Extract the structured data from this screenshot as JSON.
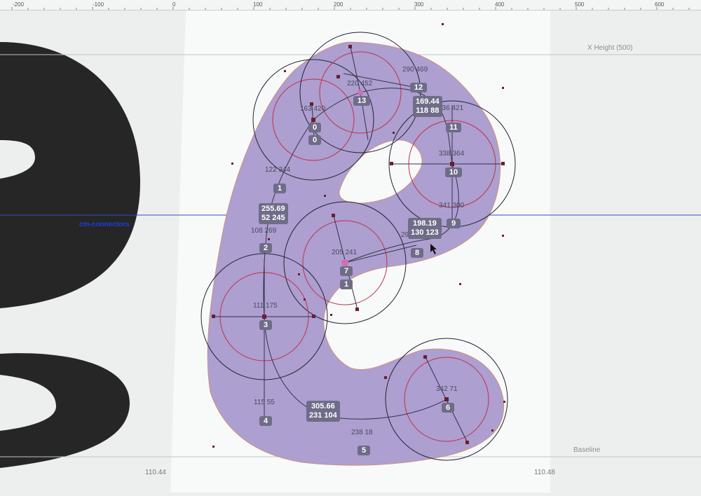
{
  "ruler": {
    "ticks": [
      "-200",
      "-100",
      "0",
      "100",
      "200",
      "300",
      "400",
      "500",
      "600"
    ]
  },
  "guides": {
    "x_height": "X Height (500)",
    "baseline": "Baseline",
    "layer_name": "cm-connectors"
  },
  "sidebearings": {
    "left": "110.44",
    "right": "110.48"
  },
  "nodes": [
    {
      "index": "0",
      "coord": "163 420"
    },
    {
      "index": "1",
      "coord": "122 344"
    },
    {
      "index": "2",
      "coord": "108 269"
    },
    {
      "index": "3",
      "coord": "111 175"
    },
    {
      "index": "4",
      "coord": "115 55"
    },
    {
      "index": "5",
      "coord": "238 18"
    },
    {
      "index": "6",
      "coord": "342 71"
    },
    {
      "index": "7",
      "coord": "205 241"
    },
    {
      "index": "8",
      "coord": "298 263"
    },
    {
      "index": "9",
      "coord": "341 300"
    },
    {
      "index": "10",
      "coord": "338 364"
    },
    {
      "index": "11",
      "coord": "336 421"
    },
    {
      "index": "12",
      "coord": "290 469"
    },
    {
      "index": "13",
      "coord": "220 452"
    }
  ],
  "extra_tags": {
    "node7_sub": "1",
    "node0_sub": "0"
  },
  "measure_chips": [
    {
      "line1": "169.44",
      "line2": "118 88"
    },
    {
      "line1": "255.69",
      "line2": "52 245"
    },
    {
      "line1": "198.19",
      "line2": "130 123"
    },
    {
      "line1": "305.66",
      "line2": "231 104"
    }
  ],
  "colors": {
    "glyph_fill": "#ad9fd0",
    "neighbor_glyph": "#262626",
    "circle_red": "#c0304a",
    "circle_dark": "#222233",
    "guide_blue": "#2b49d8"
  }
}
